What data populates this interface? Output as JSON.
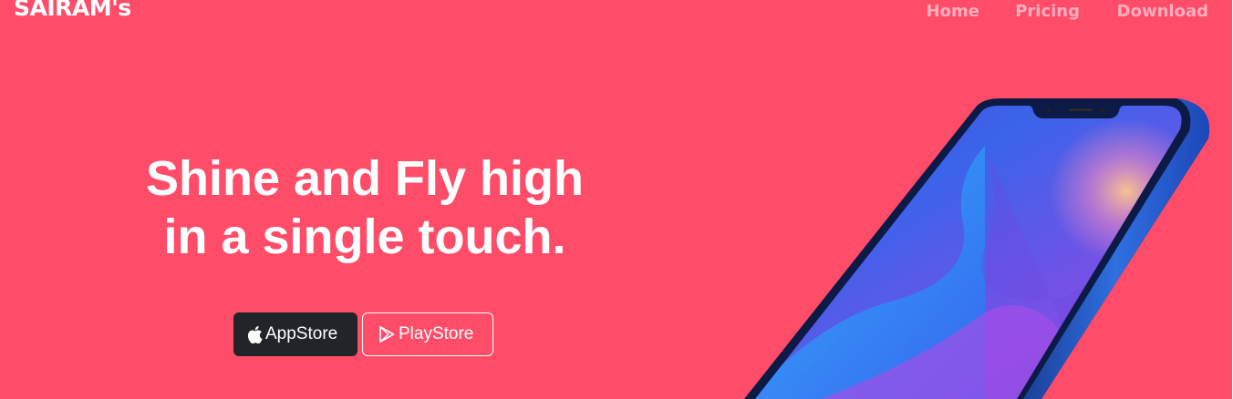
{
  "navbar": {
    "brand": "SAIRAM's",
    "links": [
      "Home",
      "Pricing",
      "Download"
    ]
  },
  "hero": {
    "headline_line1": "Shine and Fly high",
    "headline_line2": "in a single touch.",
    "buttons": {
      "appstore_label": "AppStore",
      "playstore_label": "PlayStore"
    }
  },
  "colors": {
    "background": "#ff4c68",
    "appstore_button": "#212529",
    "nav_link": "rgba(255,255,255,0.55)",
    "text": "#ffffff"
  },
  "icons": {
    "appstore": "apple-icon",
    "playstore": "google-play-icon"
  }
}
